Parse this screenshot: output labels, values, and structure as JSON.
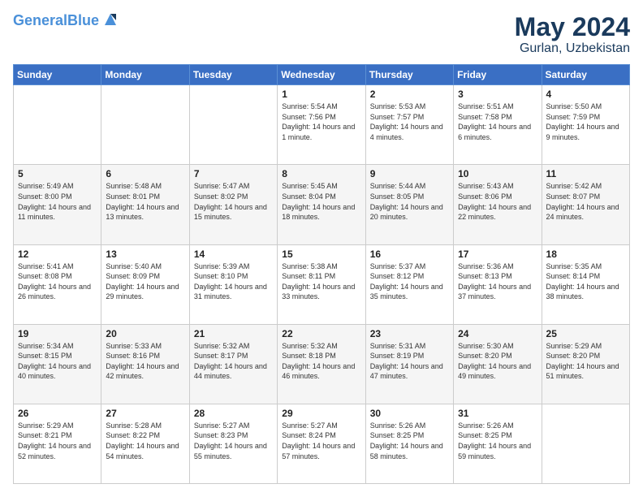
{
  "logo": {
    "line1": "General",
    "line2": "Blue"
  },
  "header": {
    "month_year": "May 2024",
    "location": "Gurlan, Uzbekistan"
  },
  "days_of_week": [
    "Sunday",
    "Monday",
    "Tuesday",
    "Wednesday",
    "Thursday",
    "Friday",
    "Saturday"
  ],
  "weeks": [
    [
      {
        "day": "",
        "sunrise": "",
        "sunset": "",
        "daylight": ""
      },
      {
        "day": "",
        "sunrise": "",
        "sunset": "",
        "daylight": ""
      },
      {
        "day": "",
        "sunrise": "",
        "sunset": "",
        "daylight": ""
      },
      {
        "day": "1",
        "sunrise": "Sunrise: 5:54 AM",
        "sunset": "Sunset: 7:56 PM",
        "daylight": "Daylight: 14 hours and 1 minute."
      },
      {
        "day": "2",
        "sunrise": "Sunrise: 5:53 AM",
        "sunset": "Sunset: 7:57 PM",
        "daylight": "Daylight: 14 hours and 4 minutes."
      },
      {
        "day": "3",
        "sunrise": "Sunrise: 5:51 AM",
        "sunset": "Sunset: 7:58 PM",
        "daylight": "Daylight: 14 hours and 6 minutes."
      },
      {
        "day": "4",
        "sunrise": "Sunrise: 5:50 AM",
        "sunset": "Sunset: 7:59 PM",
        "daylight": "Daylight: 14 hours and 9 minutes."
      }
    ],
    [
      {
        "day": "5",
        "sunrise": "Sunrise: 5:49 AM",
        "sunset": "Sunset: 8:00 PM",
        "daylight": "Daylight: 14 hours and 11 minutes."
      },
      {
        "day": "6",
        "sunrise": "Sunrise: 5:48 AM",
        "sunset": "Sunset: 8:01 PM",
        "daylight": "Daylight: 14 hours and 13 minutes."
      },
      {
        "day": "7",
        "sunrise": "Sunrise: 5:47 AM",
        "sunset": "Sunset: 8:02 PM",
        "daylight": "Daylight: 14 hours and 15 minutes."
      },
      {
        "day": "8",
        "sunrise": "Sunrise: 5:45 AM",
        "sunset": "Sunset: 8:04 PM",
        "daylight": "Daylight: 14 hours and 18 minutes."
      },
      {
        "day": "9",
        "sunrise": "Sunrise: 5:44 AM",
        "sunset": "Sunset: 8:05 PM",
        "daylight": "Daylight: 14 hours and 20 minutes."
      },
      {
        "day": "10",
        "sunrise": "Sunrise: 5:43 AM",
        "sunset": "Sunset: 8:06 PM",
        "daylight": "Daylight: 14 hours and 22 minutes."
      },
      {
        "day": "11",
        "sunrise": "Sunrise: 5:42 AM",
        "sunset": "Sunset: 8:07 PM",
        "daylight": "Daylight: 14 hours and 24 minutes."
      }
    ],
    [
      {
        "day": "12",
        "sunrise": "Sunrise: 5:41 AM",
        "sunset": "Sunset: 8:08 PM",
        "daylight": "Daylight: 14 hours and 26 minutes."
      },
      {
        "day": "13",
        "sunrise": "Sunrise: 5:40 AM",
        "sunset": "Sunset: 8:09 PM",
        "daylight": "Daylight: 14 hours and 29 minutes."
      },
      {
        "day": "14",
        "sunrise": "Sunrise: 5:39 AM",
        "sunset": "Sunset: 8:10 PM",
        "daylight": "Daylight: 14 hours and 31 minutes."
      },
      {
        "day": "15",
        "sunrise": "Sunrise: 5:38 AM",
        "sunset": "Sunset: 8:11 PM",
        "daylight": "Daylight: 14 hours and 33 minutes."
      },
      {
        "day": "16",
        "sunrise": "Sunrise: 5:37 AM",
        "sunset": "Sunset: 8:12 PM",
        "daylight": "Daylight: 14 hours and 35 minutes."
      },
      {
        "day": "17",
        "sunrise": "Sunrise: 5:36 AM",
        "sunset": "Sunset: 8:13 PM",
        "daylight": "Daylight: 14 hours and 37 minutes."
      },
      {
        "day": "18",
        "sunrise": "Sunrise: 5:35 AM",
        "sunset": "Sunset: 8:14 PM",
        "daylight": "Daylight: 14 hours and 38 minutes."
      }
    ],
    [
      {
        "day": "19",
        "sunrise": "Sunrise: 5:34 AM",
        "sunset": "Sunset: 8:15 PM",
        "daylight": "Daylight: 14 hours and 40 minutes."
      },
      {
        "day": "20",
        "sunrise": "Sunrise: 5:33 AM",
        "sunset": "Sunset: 8:16 PM",
        "daylight": "Daylight: 14 hours and 42 minutes."
      },
      {
        "day": "21",
        "sunrise": "Sunrise: 5:32 AM",
        "sunset": "Sunset: 8:17 PM",
        "daylight": "Daylight: 14 hours and 44 minutes."
      },
      {
        "day": "22",
        "sunrise": "Sunrise: 5:32 AM",
        "sunset": "Sunset: 8:18 PM",
        "daylight": "Daylight: 14 hours and 46 minutes."
      },
      {
        "day": "23",
        "sunrise": "Sunrise: 5:31 AM",
        "sunset": "Sunset: 8:19 PM",
        "daylight": "Daylight: 14 hours and 47 minutes."
      },
      {
        "day": "24",
        "sunrise": "Sunrise: 5:30 AM",
        "sunset": "Sunset: 8:20 PM",
        "daylight": "Daylight: 14 hours and 49 minutes."
      },
      {
        "day": "25",
        "sunrise": "Sunrise: 5:29 AM",
        "sunset": "Sunset: 8:20 PM",
        "daylight": "Daylight: 14 hours and 51 minutes."
      }
    ],
    [
      {
        "day": "26",
        "sunrise": "Sunrise: 5:29 AM",
        "sunset": "Sunset: 8:21 PM",
        "daylight": "Daylight: 14 hours and 52 minutes."
      },
      {
        "day": "27",
        "sunrise": "Sunrise: 5:28 AM",
        "sunset": "Sunset: 8:22 PM",
        "daylight": "Daylight: 14 hours and 54 minutes."
      },
      {
        "day": "28",
        "sunrise": "Sunrise: 5:27 AM",
        "sunset": "Sunset: 8:23 PM",
        "daylight": "Daylight: 14 hours and 55 minutes."
      },
      {
        "day": "29",
        "sunrise": "Sunrise: 5:27 AM",
        "sunset": "Sunset: 8:24 PM",
        "daylight": "Daylight: 14 hours and 57 minutes."
      },
      {
        "day": "30",
        "sunrise": "Sunrise: 5:26 AM",
        "sunset": "Sunset: 8:25 PM",
        "daylight": "Daylight: 14 hours and 58 minutes."
      },
      {
        "day": "31",
        "sunrise": "Sunrise: 5:26 AM",
        "sunset": "Sunset: 8:25 PM",
        "daylight": "Daylight: 14 hours and 59 minutes."
      },
      {
        "day": "",
        "sunrise": "",
        "sunset": "",
        "daylight": ""
      }
    ]
  ]
}
